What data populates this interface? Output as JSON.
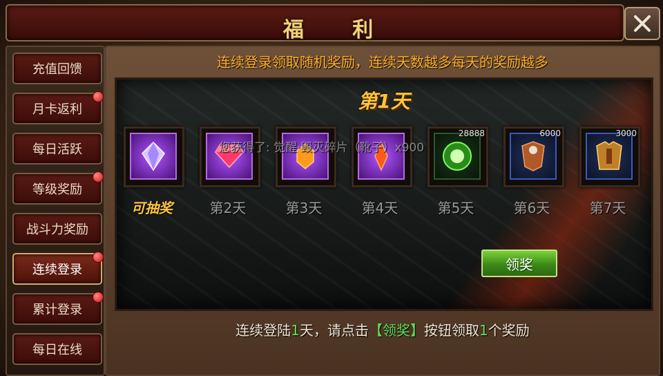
{
  "window": {
    "title": "福 利"
  },
  "sidebar": {
    "items": [
      {
        "label": "充值回馈",
        "badge": false,
        "active": false
      },
      {
        "label": "月卡返利",
        "badge": true,
        "active": false
      },
      {
        "label": "每日活跃",
        "badge": false,
        "active": false
      },
      {
        "label": "等级奖励",
        "badge": true,
        "active": false
      },
      {
        "label": "战斗力奖励",
        "badge": false,
        "active": false
      },
      {
        "label": "连续登录",
        "badge": true,
        "active": true
      },
      {
        "label": "累计登录",
        "badge": true,
        "active": false
      },
      {
        "label": "每日在线",
        "badge": false,
        "active": false
      }
    ]
  },
  "main": {
    "banner": "连续登录领取随机奖励，连续天数越多每天的奖励越多",
    "day_title": "第1天",
    "toast": "您获得了: 觉醒·毁灭碎片（靴子）x900",
    "rewards": [
      {
        "icon": "purple-gem-icon",
        "label": "可抽奖",
        "qty": ""
      },
      {
        "icon": "red-gem-icon",
        "label": "第2天",
        "qty": ""
      },
      {
        "icon": "orange-gem-icon",
        "label": "第3天",
        "qty": ""
      },
      {
        "icon": "flame-gem-icon",
        "label": "第4天",
        "qty": ""
      },
      {
        "icon": "green-orb-icon",
        "label": "第5天",
        "qty": "28888"
      },
      {
        "icon": "armor-shoulder-icon",
        "label": "第6天",
        "qty": "6000"
      },
      {
        "icon": "armor-chest-icon",
        "label": "第7天",
        "qty": "3000"
      }
    ],
    "claim_button": "领奖",
    "footer": {
      "p1": "连续登陆",
      "n1": "1",
      "p2": "天，请点击",
      "btn": "【领奖】",
      "p3": "按钮领取",
      "n2": "1",
      "p4": "个奖励"
    }
  }
}
